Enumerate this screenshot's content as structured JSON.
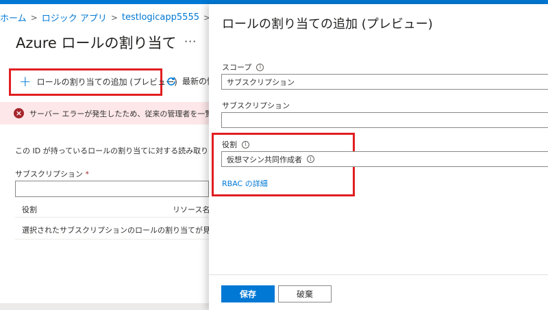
{
  "breadcrumb": {
    "home": "ホーム",
    "logic_apps": "ロジック アプリ",
    "app": "testlogicapp5555"
  },
  "left": {
    "title": "Azure ロールの割り当て",
    "more": "···",
    "add_label": "ロールの割り当ての追加 (プレビュー)",
    "refresh_label": "最新の情報に更新",
    "error_text": "サーバー エラーが発生したため、従来の管理者を一覧表示できませんでした。",
    "description": "この ID が持っているロールの割り当てに対する読み取りアクセス許可",
    "subscription_label": "サブスクリプション",
    "required_mark": "*",
    "col_role": "役割",
    "col_resource": "リソース名",
    "empty_message": "選択されたサブスクリプションのロールの割り当てが見つかりませんでした"
  },
  "panel": {
    "title": "ロールの割り当ての追加 (プレビュー)",
    "scope_label": "スコープ",
    "scope_value": "サブスクリプション",
    "subscription_label": "サブスクリプション",
    "subscription_value": "",
    "role_label": "役割",
    "role_value": "仮想マシン共同作成者",
    "rbac_link": "RBAC の詳細",
    "save": "保存",
    "discard": "破棄",
    "info_glyph": "i"
  },
  "colors": {
    "accent": "#0078d4",
    "highlight": "#e11d21",
    "error_bg": "#fde7e9",
    "error_icon": "#a4262c"
  }
}
